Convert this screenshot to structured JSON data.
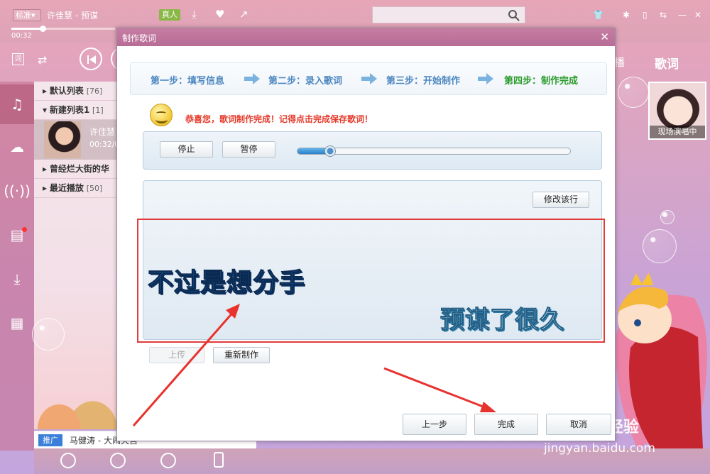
{
  "player": {
    "quality_label": "标准",
    "now_playing": "许佳慧 - 预谋",
    "real_badge": "真人",
    "elapsed": "00:32",
    "progress": 0.3,
    "tab_partial": "播",
    "tab_lyric": "歌词"
  },
  "playlist": {
    "groups": [
      {
        "name": "默认列表",
        "count": "[76]"
      },
      {
        "name": "新建列表1",
        "count": "[1]"
      },
      {
        "name": "曾经烂大街的华",
        "count": ""
      },
      {
        "name": "最近播放",
        "count": "[50]"
      }
    ],
    "current_song": {
      "artist": "许佳慧",
      "time": "00:32/0"
    }
  },
  "ad": {
    "badge": "推广",
    "text": "马健涛 - 大闹天宫"
  },
  "artist_card": {
    "caption": "现场演唱中"
  },
  "dialog": {
    "title": "制作歌词",
    "steps": [
      "第一步：填写信息",
      "第二步：录入歌词",
      "第三步：开始制作",
      "第四步：制作完成"
    ],
    "message": "恭喜您，歌词制作完成！记得点击完成保存歌词！",
    "stop_label": "停止",
    "pause_label": "暂停",
    "playback_position": 0.12,
    "modify_line_label": "修改该行",
    "lyric_line_1": "不过是想分手",
    "lyric_line_2": "预谋了很久",
    "upload_label": "上传",
    "remake_label": "重新制作",
    "prev_label": "上一步",
    "finish_label": "完成",
    "cancel_label": "取消"
  },
  "watermark": {
    "brand": "Bai du 经验",
    "url": "jingyan.baidu.com"
  },
  "colors": {
    "accent_pink": "#c77da2",
    "step_blue": "#4b86c0",
    "step_done": "#2a9b2a",
    "highlight_red": "#e33a3a"
  }
}
